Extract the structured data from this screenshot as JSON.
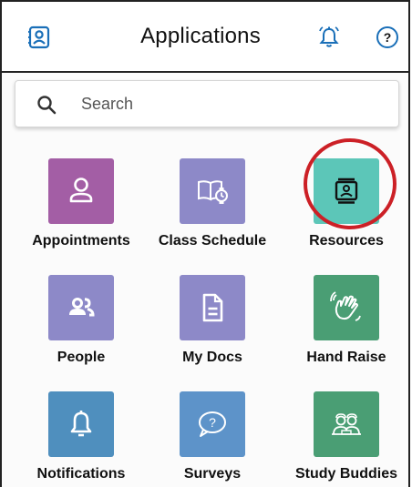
{
  "header": {
    "title": "Applications"
  },
  "search": {
    "placeholder": "Search"
  },
  "apps": [
    {
      "label": "Appointments",
      "color": "#a35ea5",
      "icon": "person-icon"
    },
    {
      "label": "Class Schedule",
      "color": "#8d89c8",
      "icon": "book-clock-icon"
    },
    {
      "label": "Resources",
      "color": "#5cc6b8",
      "icon": "resources-icon"
    },
    {
      "label": "People",
      "color": "#8d89c8",
      "icon": "people-icon"
    },
    {
      "label": "My Docs",
      "color": "#8d89c8",
      "icon": "document-icon"
    },
    {
      "label": "Hand Raise",
      "color": "#4a9e74",
      "icon": "hand-wave-icon"
    },
    {
      "label": "Notifications",
      "color": "#4f8fbe",
      "icon": "bell-icon"
    },
    {
      "label": "Surveys",
      "color": "#5d93c9",
      "icon": "question-bubble-icon"
    },
    {
      "label": "Study Buddies",
      "color": "#4a9e74",
      "icon": "study-buddies-icon"
    }
  ],
  "colors": {
    "header_icon": "#1a6fb8",
    "highlight_ring": "#cc2026"
  }
}
